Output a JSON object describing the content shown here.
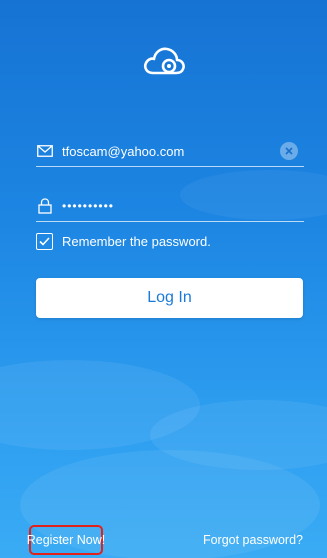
{
  "login": {
    "logo_icon": "cloud-camera-icon",
    "email": {
      "icon": "envelope-icon",
      "value": "tfoscam@yahoo.com",
      "clear_icon": "clear-icon"
    },
    "password": {
      "icon": "lock-icon",
      "value": "••••••••••"
    },
    "remember": {
      "checked": true,
      "label": "Remember the password."
    },
    "login_button_label": "Log In",
    "register_link": "Register Now!",
    "forgot_link": "Forgot password?"
  },
  "colors": {
    "background_top": "#1673d4",
    "background_bottom": "#3aabf4",
    "button_text": "#1a7ad8",
    "highlight_box": "#e0221b"
  }
}
